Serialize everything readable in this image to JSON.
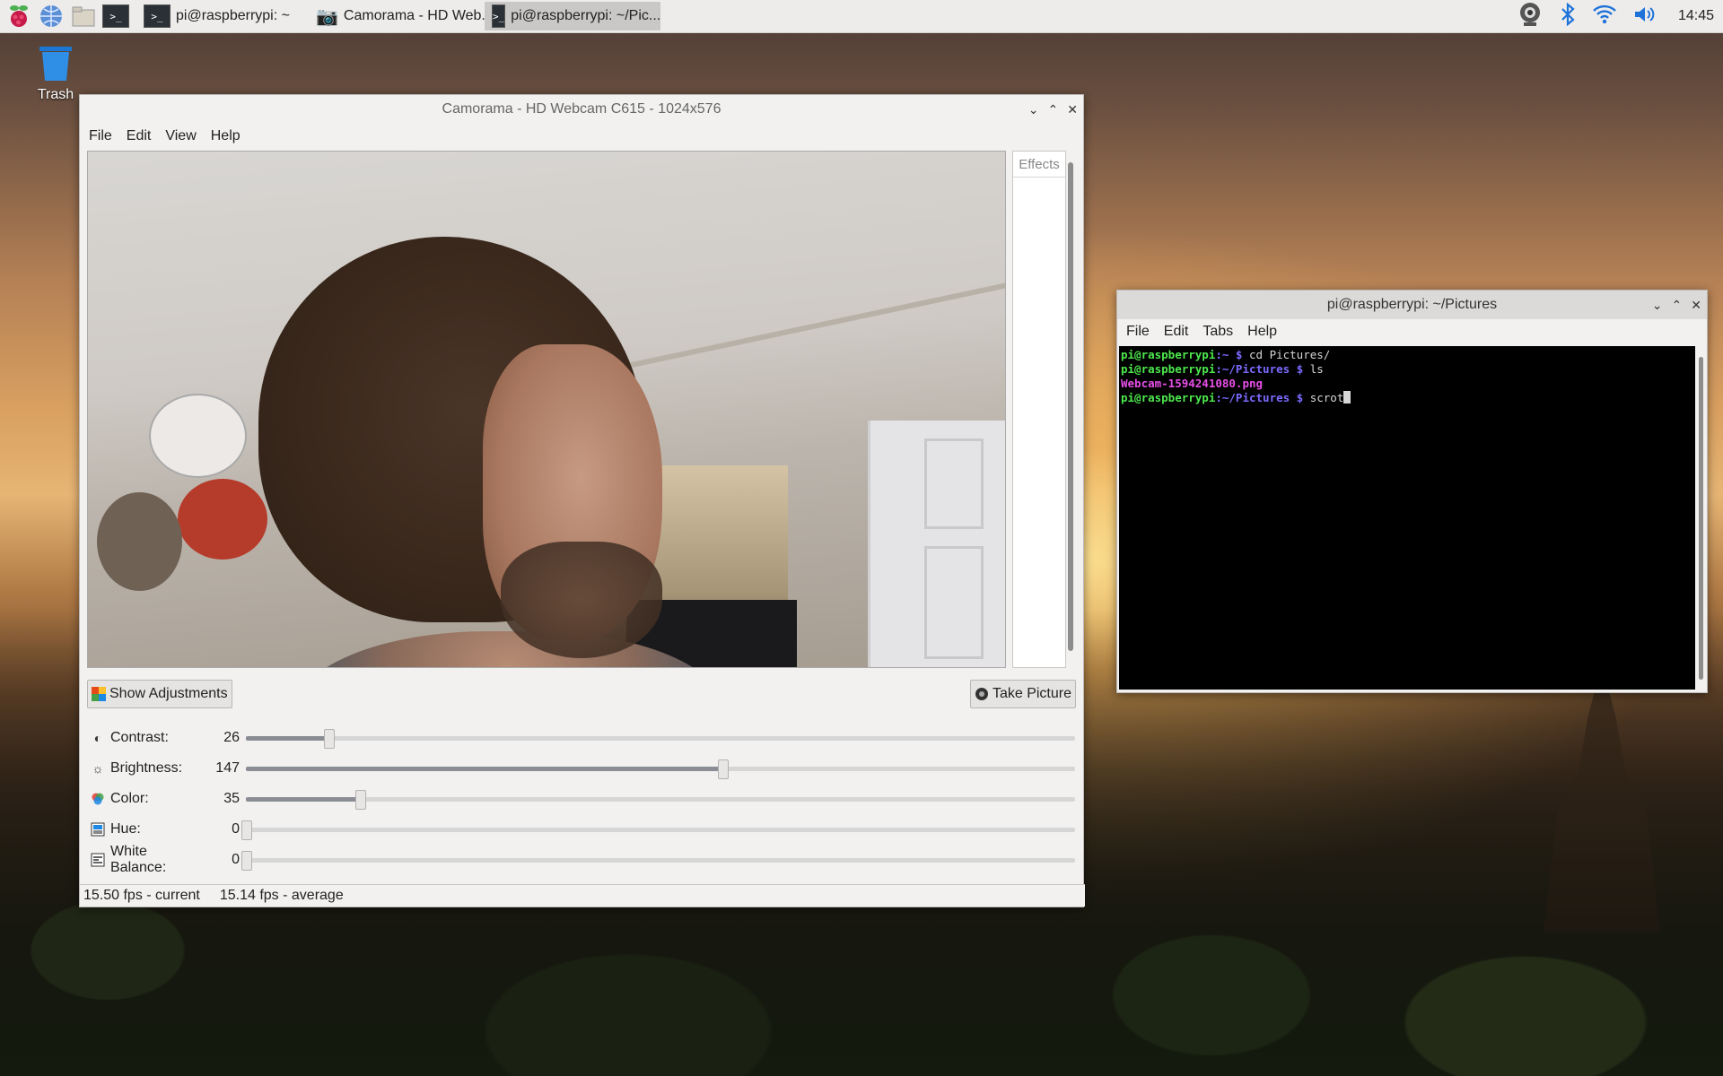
{
  "taskbar": {
    "tasks": [
      {
        "label": "pi@raspberrypi: ~"
      },
      {
        "label": "Camorama - HD Web..."
      },
      {
        "label": "pi@raspberrypi: ~/Pic..."
      }
    ],
    "clock": "14:45"
  },
  "desktop": {
    "trash_label": "Trash"
  },
  "camorama": {
    "title": "Camorama - HD Webcam C615 - 1024x576",
    "menu": [
      "File",
      "Edit",
      "View",
      "Help"
    ],
    "effects_label": "Effects",
    "show_adjustments_label": "Show Adjustments",
    "take_picture_label": "Take Picture",
    "sliders": [
      {
        "label": "Contrast:",
        "value": "26",
        "fraction": 0.1
      },
      {
        "label": "Brightness:",
        "value": "147",
        "fraction": 0.575
      },
      {
        "label": "Color:",
        "value": "35",
        "fraction": 0.137
      },
      {
        "label": "Hue:",
        "value": "0",
        "fraction": 0.0
      },
      {
        "label": "White Balance:",
        "value": "0",
        "fraction": 0.0
      }
    ],
    "status_current": "15.50 fps - current",
    "status_average": "15.14 fps - average"
  },
  "terminal": {
    "title": "pi@raspberrypi: ~/Pictures",
    "menu": [
      "File",
      "Edit",
      "Tabs",
      "Help"
    ],
    "lines": [
      {
        "user": "pi@raspberrypi",
        "path": ":~ $ ",
        "cmd": "cd Pictures/"
      },
      {
        "user": "pi@raspberrypi",
        "path": ":~/Pictures $ ",
        "cmd": "ls"
      },
      {
        "file": "Webcam-1594241080.png"
      },
      {
        "user": "pi@raspberrypi",
        "path": ":~/Pictures $ ",
        "cmd": "scrot"
      }
    ]
  },
  "colors": {
    "prompt_user": "#4ee84e",
    "prompt_path": "#7b6bff",
    "file_listing": "#e64fe6",
    "slider_fill": "#8a8d94"
  }
}
